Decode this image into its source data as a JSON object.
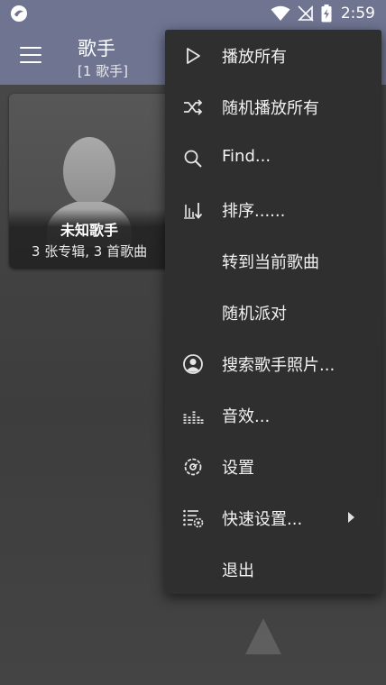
{
  "status_bar": {
    "time": "2:59",
    "icons": [
      "app-notification-icon",
      "wifi-icon",
      "signal-off-icon",
      "battery-charging-icon"
    ]
  },
  "toolbar": {
    "menu_icon": "hamburger-menu-icon",
    "title": "歌手",
    "subtitle": "[1 歌手]"
  },
  "artist_card": {
    "name": "未知歌手",
    "meta": "3 张专辑, 3 首歌曲",
    "image_icon": "person-silhouette-icon"
  },
  "menu": {
    "items": [
      {
        "label": "播放所有",
        "icon": "play-icon"
      },
      {
        "label": "随机播放所有",
        "icon": "shuffle-icon"
      },
      {
        "label": "Find...",
        "icon": "search-icon"
      },
      {
        "label": "排序......",
        "icon": "sort-icon"
      },
      {
        "label": "转到当前歌曲",
        "icon": ""
      },
      {
        "label": "随机派对",
        "icon": ""
      },
      {
        "label": "搜索歌手照片...",
        "icon": "account-circle-icon"
      },
      {
        "label": "音效...",
        "icon": "equalizer-icon"
      },
      {
        "label": "设置",
        "icon": "settings-icon"
      },
      {
        "label": "快速设置...",
        "icon": "list-settings-icon",
        "has_submenu": true
      },
      {
        "label": "退出",
        "icon": ""
      }
    ]
  },
  "colors": {
    "toolbar": "#6f7591",
    "menu_background": "#2f2f2f",
    "background": "#404040"
  }
}
